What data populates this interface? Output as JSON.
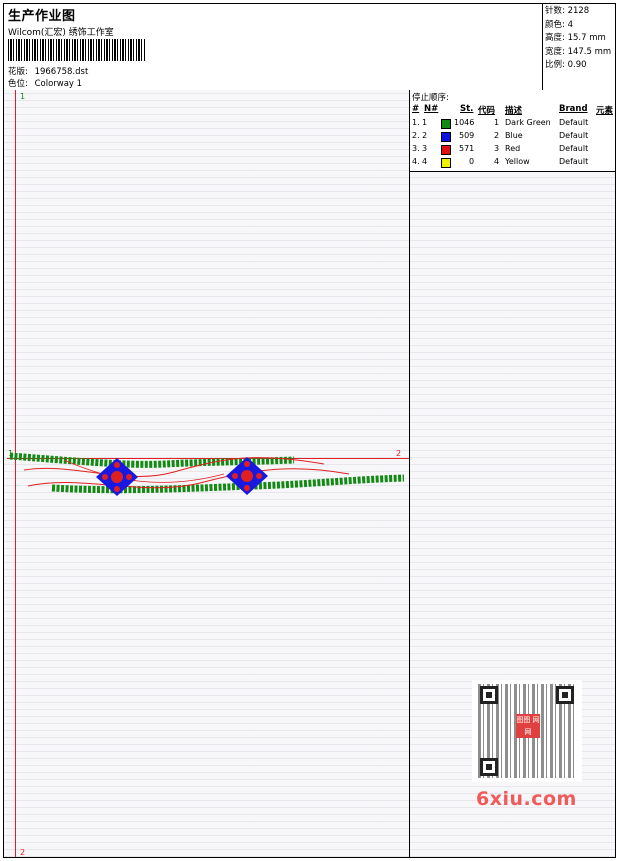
{
  "header": {
    "title": "生产作业图",
    "studio": "Wilcom(汇宏) 绣饰工作室",
    "design_label": "花版:",
    "design_file": "1966758.dst",
    "colorway_label": "色位:",
    "colorway": "Colorway 1"
  },
  "stats": [
    {
      "label": "针数:",
      "value": "2128"
    },
    {
      "label": "颜色:",
      "value": "4"
    },
    {
      "label": "高度:",
      "value": "15.7 mm"
    },
    {
      "label": "宽度:",
      "value": "147.5 mm"
    },
    {
      "label": "比例:",
      "value": "0.90"
    }
  ],
  "design_markers": {
    "top": "1",
    "bottom": "2",
    "left": "1",
    "right": "2"
  },
  "stop_sequence": {
    "title": "停止顺序:",
    "columns": [
      "#",
      "N#",
      "St.",
      "代码",
      "描述",
      "Brand",
      "元素"
    ],
    "rows": [
      {
        "num": "1.",
        "n": "1",
        "color": "#138a13",
        "stitches": "1046",
        "code": "1",
        "desc": "Dark Green",
        "brand": "Default"
      },
      {
        "num": "2.",
        "n": "2",
        "color": "#1010e0",
        "stitches": "509",
        "code": "2",
        "desc": "Blue",
        "brand": "Default"
      },
      {
        "num": "3.",
        "n": "3",
        "color": "#e01010",
        "stitches": "571",
        "code": "3",
        "desc": "Red",
        "brand": "Default"
      },
      {
        "num": "4.",
        "n": "4",
        "color": "#f0f000",
        "stitches": "0",
        "code": "4",
        "desc": "Yellow",
        "brand": "Default"
      }
    ]
  },
  "stamp": {
    "seal": "图图 网网",
    "watermark": "6xiu.com"
  }
}
